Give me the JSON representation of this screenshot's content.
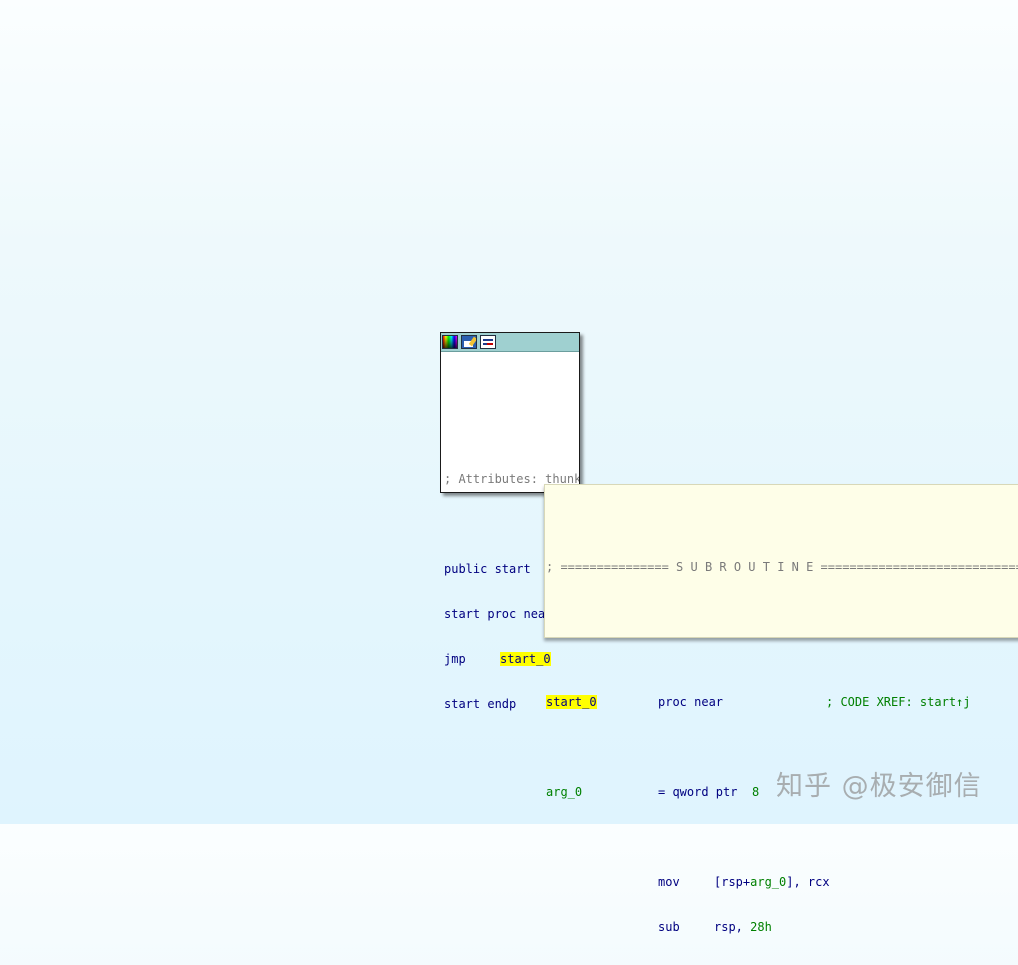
{
  "thunk_node": {
    "titlebar_icons": [
      "color-picker-icon",
      "rename-icon",
      "graph-view-icon"
    ],
    "attributes_comment": "; Attributes: thunk",
    "public_line": "public start",
    "proc_line": "start proc near",
    "jmp_mnemonic": "jmp",
    "jmp_target": "start_0",
    "endp_line": "start endp"
  },
  "sub_node": {
    "separator": "; =============== S U B R O U T I N E =======================================",
    "label": "start_0",
    "proc_decl": "proc near",
    "xref_comment": "; CODE XREF: start↑j",
    "arg_name": "arg_0",
    "arg_def_prefix": "= qword ptr",
    "arg_def_value": "8",
    "instructions": [
      {
        "mnemonic": "mov",
        "op_prefix": "[rsp+",
        "op_ref": "arg_0",
        "op_suffix": "], rcx",
        "op_num": ""
      },
      {
        "mnemonic": "sub",
        "op_prefix": "rsp, ",
        "op_ref": "",
        "op_suffix": "",
        "op_num": "28h"
      }
    ]
  },
  "watermark": "知乎 @极安御信",
  "colors": {
    "highlight": "#ffff00",
    "code_blue": "#000080",
    "code_green": "#008000",
    "comment_gray": "#7a7a7a",
    "titlebar": "#9fd0d0",
    "sub_background": "#fefee8"
  }
}
